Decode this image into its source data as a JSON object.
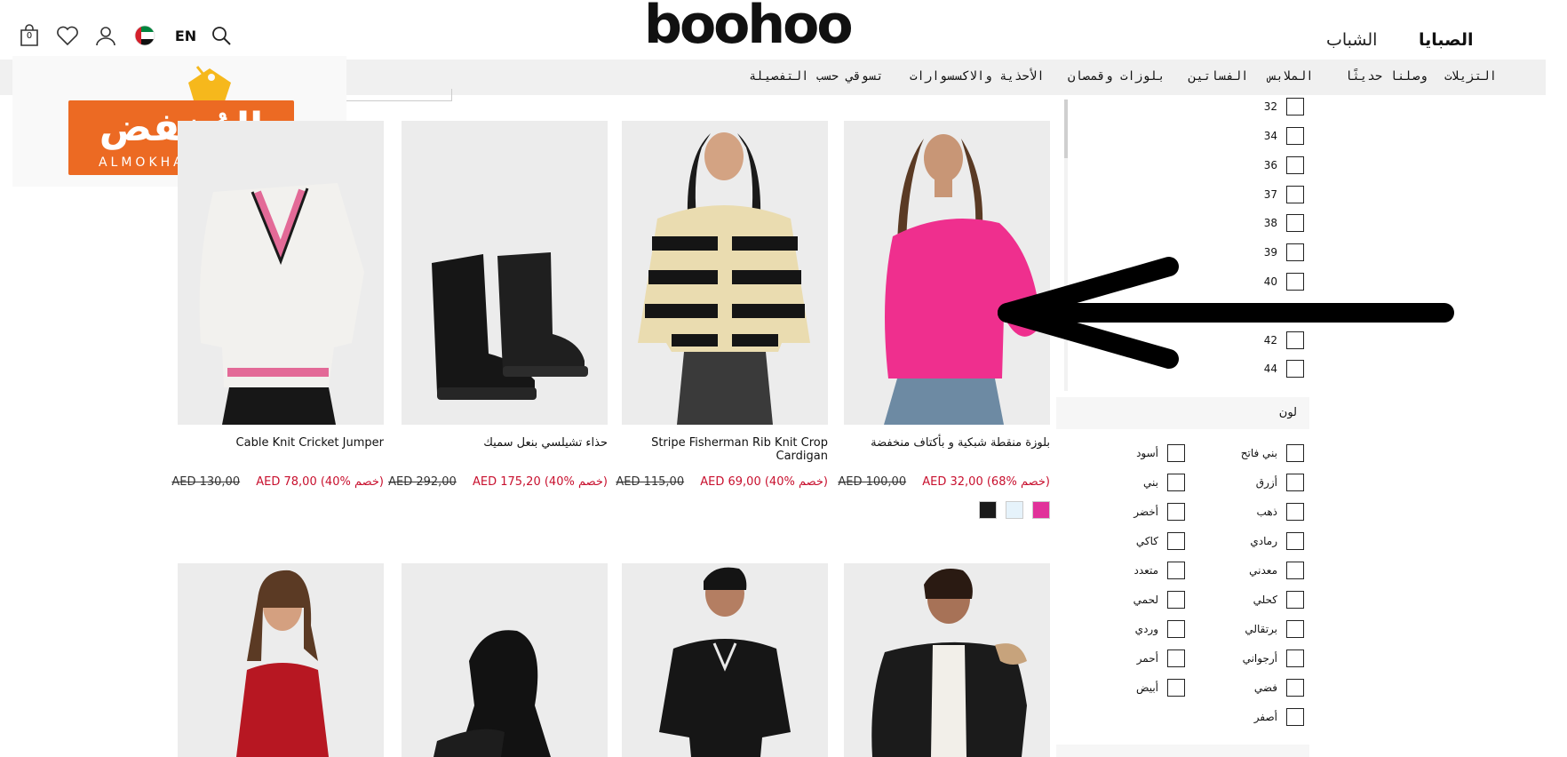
{
  "header": {
    "logo": "boohoo",
    "gender_tabs": [
      "الصبايا",
      "الشباب"
    ],
    "language": "EN",
    "bag_count": "0",
    "icons": [
      "search-icon",
      "flag-icon",
      "account-icon",
      "wishlist-icon",
      "bag-icon"
    ]
  },
  "nav": {
    "items": [
      "التزيلات",
      "وصلنا حديثًا",
      "الملابس",
      "الفساتين",
      "بلوزات وقمصان",
      "الأحذية والاكسسوارات",
      "تسوقي حسب التفصيلة"
    ]
  },
  "watermark": {
    "arabic": "المُخفض",
    "latin": "ALMOKHAFID.COM"
  },
  "products": [
    {
      "name": "بلوزة منقطة شبكية و بأكتاف منخفضة",
      "old_price": "AED 100,00",
      "new_price": "AED 32,00 (68% خصم)",
      "swatches": [
        "#e1329a",
        "#e6f3fb",
        "#1a1a1a"
      ]
    },
    {
      "name": "Stripe Fisherman Rib Knit Crop Cardigan",
      "old_price": "AED 115,00",
      "new_price": "AED 69,00 (40% خصم)"
    },
    {
      "name": "حذاء تشيلسي بنعل سميك",
      "old_price": "AED 292,00",
      "new_price": "AED 175,20 (40% خصم)"
    },
    {
      "name": "Cable Knit Cricket Jumper",
      "old_price": "AED 130,00",
      "new_price": "AED 78,00 (40% خصم)"
    }
  ],
  "filters": {
    "sizes": [
      "32",
      "34",
      "36",
      "37",
      "38",
      "39",
      "40",
      "42",
      "44"
    ],
    "color_title": "لون",
    "colors_right": [
      "بني فاتح",
      "أزرق",
      "ذهب",
      "رمادي",
      "معدني",
      "كحلي",
      "برتقالي",
      "أرجواني",
      "فضي",
      "أصفر"
    ],
    "colors_left": [
      "أسود",
      "بني",
      "أخضر",
      "كاكي",
      "متعدد",
      "لحمي",
      "وردي",
      "أحمر",
      "أبيض"
    ]
  },
  "colors": {
    "accent_red": "#c8102e",
    "watermark_orange": "#ec6a23",
    "nav_bg": "#f0f0f0"
  }
}
